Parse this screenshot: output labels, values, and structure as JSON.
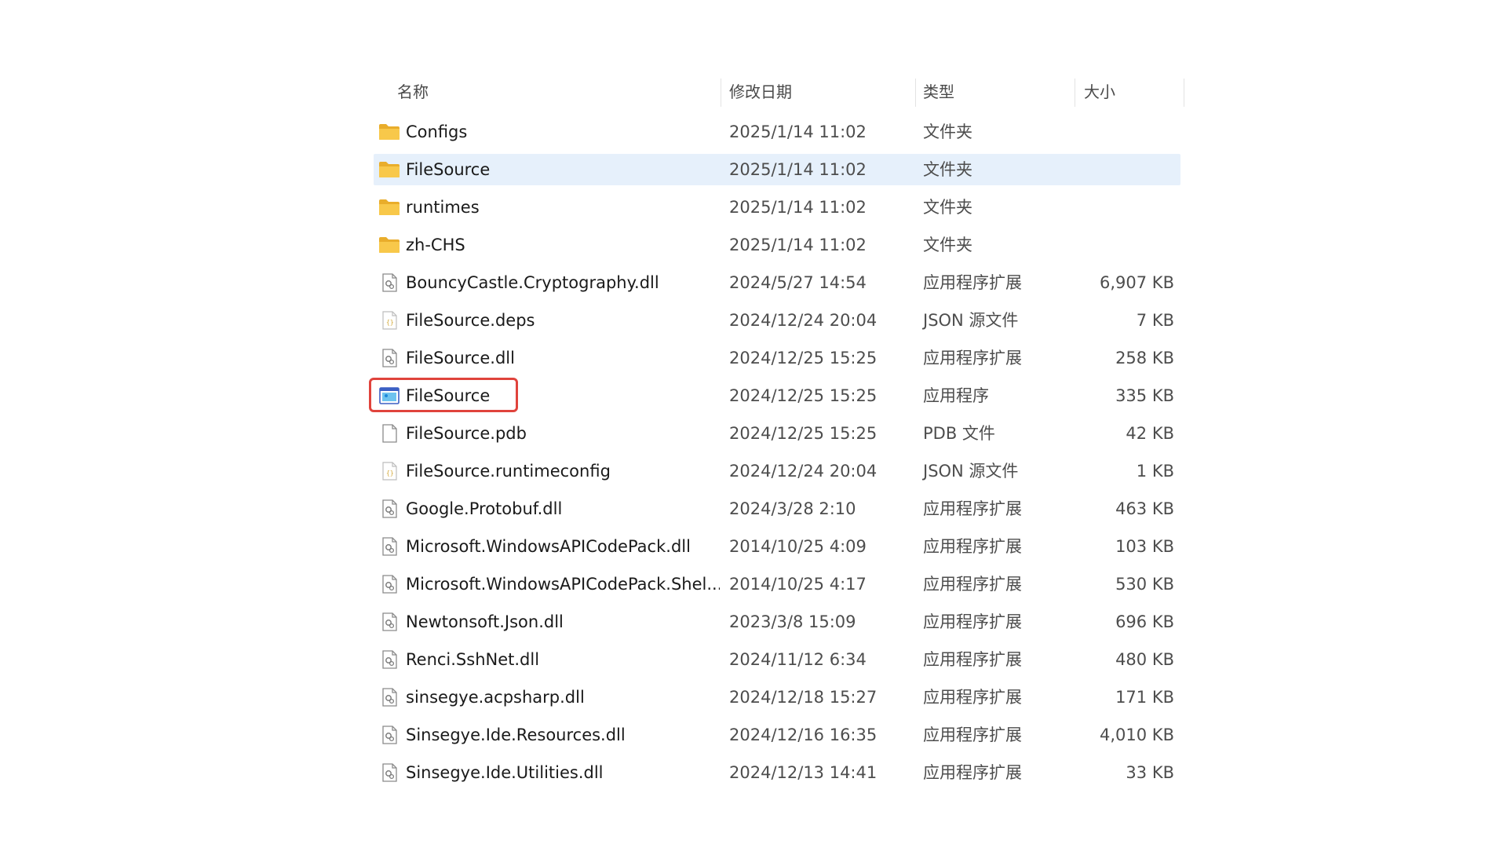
{
  "header": {
    "name": "名称",
    "date": "修改日期",
    "type": "类型",
    "size": "大小"
  },
  "files": [
    {
      "name": "Configs",
      "date": "2025/1/14 11:02",
      "type": "文件夹",
      "size": "",
      "icon": "folder-icon"
    },
    {
      "name": "FileSource",
      "date": "2025/1/14 11:02",
      "type": "文件夹",
      "size": "",
      "icon": "folder-icon",
      "selected": true
    },
    {
      "name": "runtimes",
      "date": "2025/1/14 11:02",
      "type": "文件夹",
      "size": "",
      "icon": "folder-icon"
    },
    {
      "name": "zh-CHS",
      "date": "2025/1/14 11:02",
      "type": "文件夹",
      "size": "",
      "icon": "folder-icon"
    },
    {
      "name": "BouncyCastle.Cryptography.dll",
      "date": "2024/5/27 14:54",
      "type": "应用程序扩展",
      "size": "6,907 KB",
      "icon": "dll-icon"
    },
    {
      "name": "FileSource.deps",
      "date": "2024/12/24 20:04",
      "type": "JSON 源文件",
      "size": "7 KB",
      "icon": "json-icon"
    },
    {
      "name": "FileSource.dll",
      "date": "2024/12/25 15:25",
      "type": "应用程序扩展",
      "size": "258 KB",
      "icon": "dll-icon"
    },
    {
      "name": "FileSource",
      "date": "2024/12/25 15:25",
      "type": "应用程序",
      "size": "335 KB",
      "icon": "exe-icon",
      "boxed": true
    },
    {
      "name": "FileSource.pdb",
      "date": "2024/12/25 15:25",
      "type": "PDB 文件",
      "size": "42 KB",
      "icon": "blank-file-icon"
    },
    {
      "name": "FileSource.runtimeconfig",
      "date": "2024/12/24 20:04",
      "type": "JSON 源文件",
      "size": "1 KB",
      "icon": "json-icon"
    },
    {
      "name": "Google.Protobuf.dll",
      "date": "2024/3/28 2:10",
      "type": "应用程序扩展",
      "size": "463 KB",
      "icon": "dll-icon"
    },
    {
      "name": "Microsoft.WindowsAPICodePack.dll",
      "date": "2014/10/25 4:09",
      "type": "应用程序扩展",
      "size": "103 KB",
      "icon": "dll-icon"
    },
    {
      "name": "Microsoft.WindowsAPICodePack.Shel...",
      "date": "2014/10/25 4:17",
      "type": "应用程序扩展",
      "size": "530 KB",
      "icon": "dll-icon"
    },
    {
      "name": "Newtonsoft.Json.dll",
      "date": "2023/3/8 15:09",
      "type": "应用程序扩展",
      "size": "696 KB",
      "icon": "dll-icon"
    },
    {
      "name": "Renci.SshNet.dll",
      "date": "2024/11/12 6:34",
      "type": "应用程序扩展",
      "size": "480 KB",
      "icon": "dll-icon"
    },
    {
      "name": "sinsegye.acpsharp.dll",
      "date": "2024/12/18 15:27",
      "type": "应用程序扩展",
      "size": "171 KB",
      "icon": "dll-icon"
    },
    {
      "name": "Sinsegye.Ide.Resources.dll",
      "date": "2024/12/16 16:35",
      "type": "应用程序扩展",
      "size": "4,010 KB",
      "icon": "dll-icon"
    },
    {
      "name": "Sinsegye.Ide.Utilities.dll",
      "date": "2024/12/13 14:41",
      "type": "应用程序扩展",
      "size": "33 KB",
      "icon": "dll-icon"
    }
  ],
  "colors": {
    "selection": "#e6f0fb",
    "highlight_box": "#e0433c",
    "folder": "#f8c84a"
  }
}
